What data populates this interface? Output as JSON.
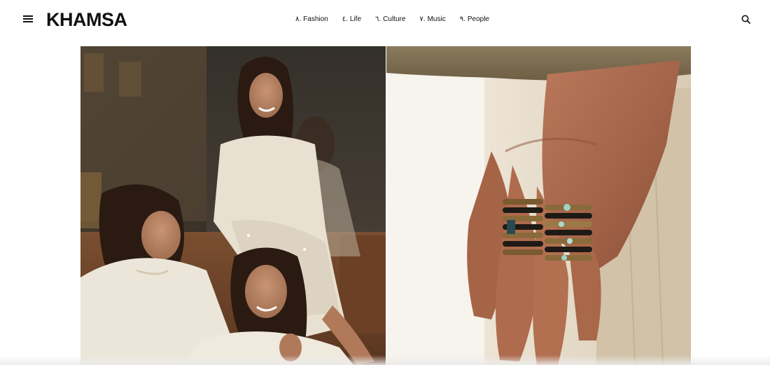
{
  "brand": {
    "logo_text": "KHAMSA"
  },
  "header": {
    "menu_icon": "hamburger-menu-icon",
    "search_icon": "search-icon"
  },
  "nav": {
    "items": [
      {
        "num": "٨.",
        "label": "Fashion"
      },
      {
        "num": "٤.",
        "label": "Life"
      },
      {
        "num": "٦.",
        "label": "Culture"
      },
      {
        "num": "٧.",
        "label": "Music"
      },
      {
        "num": "٩.",
        "label": "People"
      }
    ]
  },
  "hero": {
    "left_image": "photo of three smiling women in white lace dresses seated together",
    "right_image": "close-up photo of a hand wearing stacked gold and gemstone rings"
  },
  "colors": {
    "text": "#111111",
    "background": "#ffffff"
  }
}
